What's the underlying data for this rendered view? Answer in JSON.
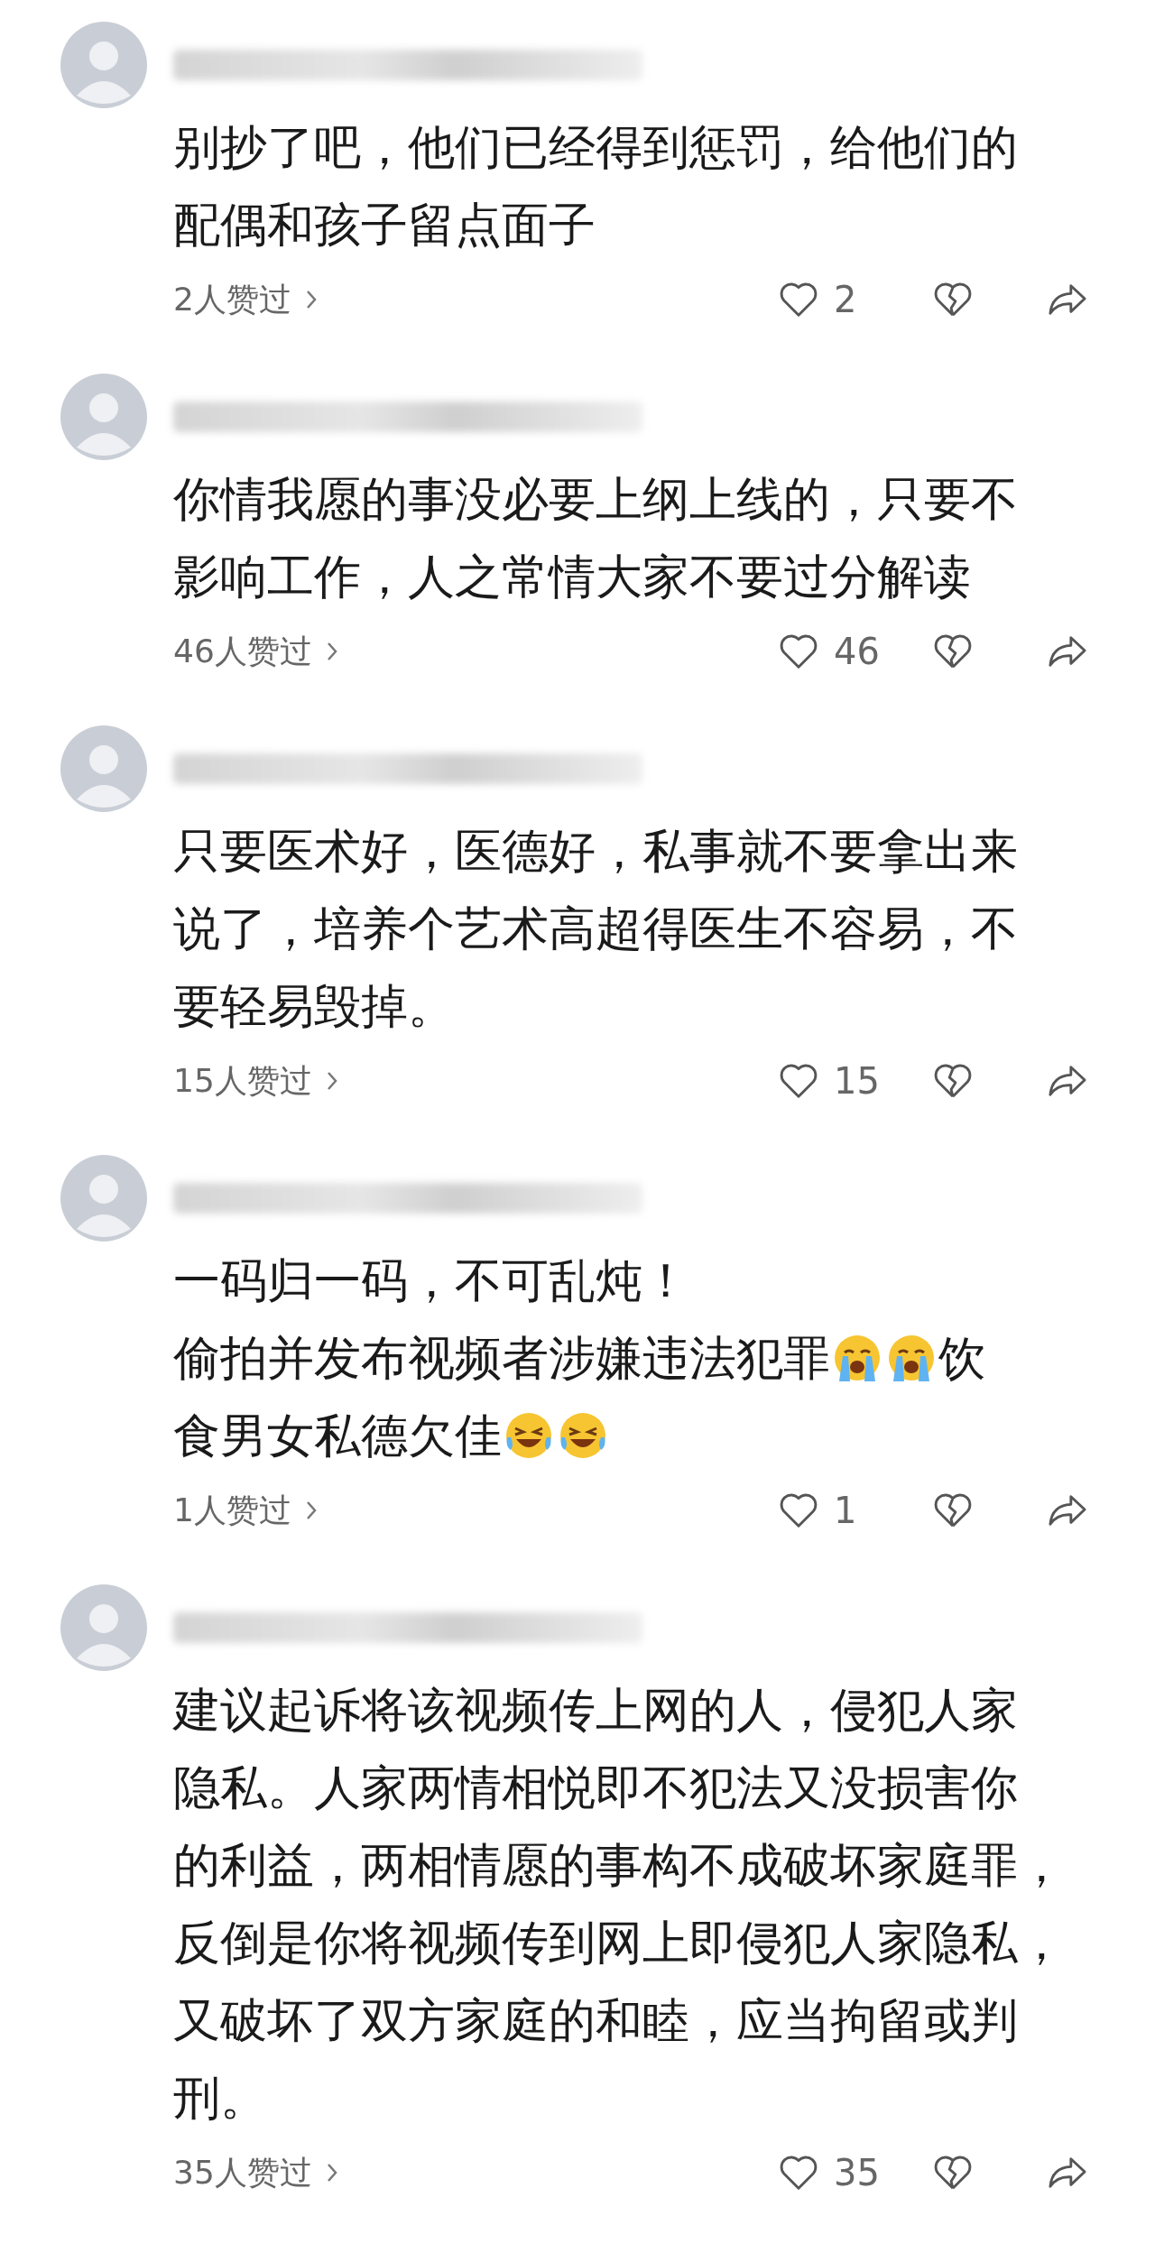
{
  "comments": [
    {
      "lines": [
        [
          {
            "kind": "text",
            "text": "别抄了吧，他们已经得到惩罚，给他们的"
          }
        ],
        [
          {
            "kind": "text",
            "text": "配偶和孩子留点面子"
          }
        ]
      ],
      "likes_label": "2人赞过",
      "like_count": "2"
    },
    {
      "lines": [
        [
          {
            "kind": "text",
            "text": "你情我愿的事没必要上纲上线的，只要不"
          }
        ],
        [
          {
            "kind": "text",
            "text": "影响工作，人之常情大家不要过分解读"
          }
        ]
      ],
      "likes_label": "46人赞过",
      "like_count": "46"
    },
    {
      "lines": [
        [
          {
            "kind": "text",
            "text": "只要医术好，医德好，私事就不要拿出来"
          }
        ],
        [
          {
            "kind": "text",
            "text": "说了，培养个艺术高超得医生不容易，不"
          }
        ],
        [
          {
            "kind": "text",
            "text": "要轻易毁掉。"
          }
        ]
      ],
      "likes_label": "15人赞过",
      "like_count": "15"
    },
    {
      "lines": [
        [
          {
            "kind": "text",
            "text": "一码归一码，不可乱炖！"
          }
        ],
        [
          {
            "kind": "text",
            "text": "偷拍并发布视频者涉嫌违法犯罪"
          },
          {
            "kind": "crying_emoji"
          },
          {
            "kind": "crying_emoji"
          },
          {
            "kind": "text",
            "text": "饮"
          }
        ],
        [
          {
            "kind": "text",
            "text": "食男女私德欠佳"
          },
          {
            "kind": "laughing_emoji"
          },
          {
            "kind": "laughing_emoji"
          }
        ]
      ],
      "likes_label": "1人赞过",
      "like_count": "1"
    },
    {
      "lines": [
        [
          {
            "kind": "text",
            "text": "建议起诉将该视频传上网的人，侵犯人家"
          }
        ],
        [
          {
            "kind": "text",
            "text": "隐私。人家两情相悦即不犯法又没损害你"
          }
        ],
        [
          {
            "kind": "text",
            "text": "的利益，两相情愿的事构不成破坏家庭罪，"
          }
        ],
        [
          {
            "kind": "text",
            "text": "反倒是你将视频传到网上即侵犯人家隐私，"
          }
        ],
        [
          {
            "kind": "text",
            "text": "又破坏了双方家庭的和睦，应当拘留或判"
          }
        ],
        [
          {
            "kind": "text",
            "text": "刑。"
          }
        ]
      ],
      "likes_label": "35人赞过",
      "like_count": "35"
    }
  ]
}
